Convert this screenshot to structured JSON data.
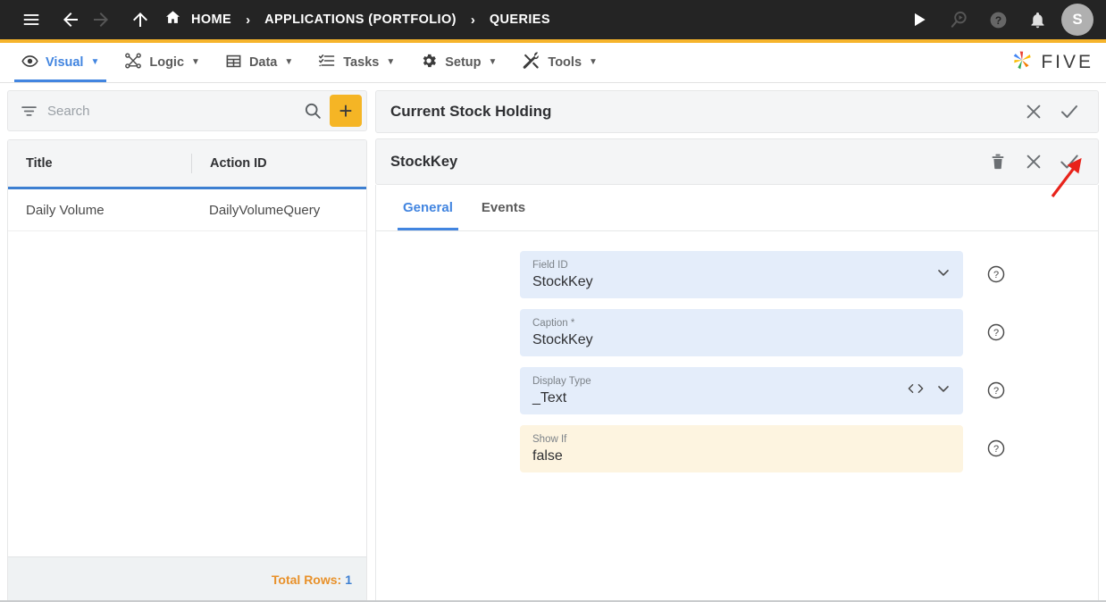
{
  "topbar": {
    "menu_icon": "hamburger-menu-icon",
    "back_icon": "arrow-left-icon",
    "forward_icon": "arrow-right-icon",
    "up_icon": "arrow-up-icon",
    "home_icon": "home-icon",
    "breadcrumbs": [
      {
        "label": "HOME"
      },
      {
        "label": "APPLICATIONS (PORTFOLIO)"
      },
      {
        "label": "QUERIES"
      }
    ],
    "separator": "›",
    "run_icon": "play-icon",
    "search_run_icon": "search-play-icon",
    "help_icon": "question-circle-icon",
    "notification_icon": "bell-icon",
    "avatar_initial": "S",
    "accent_color": "#f6b42c",
    "background_color": "#242424"
  },
  "menubar": {
    "items": [
      {
        "label": "Visual",
        "icon": "eye-icon",
        "active": true
      },
      {
        "label": "Logic",
        "icon": "nodes-icon",
        "active": false
      },
      {
        "label": "Data",
        "icon": "table-grid-icon",
        "active": false
      },
      {
        "label": "Tasks",
        "icon": "checklist-icon",
        "active": false
      },
      {
        "label": "Setup",
        "icon": "gear-icon",
        "active": false
      },
      {
        "label": "Tools",
        "icon": "tools-icon",
        "active": false
      }
    ],
    "caret": "▼",
    "brand": "FIVE",
    "active_color": "#4285e0"
  },
  "left_panel": {
    "filter_icon": "filter-icon",
    "search": {
      "value": "",
      "placeholder": "Search"
    },
    "search_icon": "magnifier-icon",
    "add_button": {
      "label": "+",
      "name": "add-record-button",
      "color": "#f5b525"
    },
    "grid": {
      "columns": [
        "Title",
        "Action ID"
      ],
      "rows": [
        {
          "title": "Daily Volume",
          "action_id": "DailyVolumeQuery"
        }
      ]
    },
    "footer": {
      "label": "Total Rows:",
      "value": "1"
    }
  },
  "right_panel": {
    "header": {
      "title": "Current Stock Holding",
      "close_icon": "close-x-icon",
      "confirm_icon": "check-icon"
    },
    "sub_header": {
      "title": "StockKey",
      "delete_icon": "trash-icon",
      "close_icon": "close-x-icon",
      "confirm_icon": "check-icon"
    },
    "tabs": [
      {
        "label": "General",
        "active": true
      },
      {
        "label": "Events",
        "active": false
      }
    ],
    "fields": [
      {
        "label": "Field ID",
        "value": "StockKey",
        "style": "blue",
        "adornments": [
          "chevron-down-icon"
        ],
        "help_icon": "question-circle-icon"
      },
      {
        "label": "Caption *",
        "value": "StockKey",
        "style": "blue",
        "adornments": [],
        "help_icon": "question-circle-icon"
      },
      {
        "label": "Display Type",
        "value": "_Text",
        "style": "blue",
        "adornments": [
          "code-brackets-icon",
          "chevron-down-icon"
        ],
        "help_icon": "question-circle-icon"
      },
      {
        "label": "Show If",
        "value": "false",
        "style": "yellow",
        "adornments": [],
        "help_icon": "question-circle-icon"
      }
    ]
  },
  "annotation": {
    "type": "red-arrow",
    "color": "#e8231b",
    "points_to": "sub-header-confirm-check-icon"
  }
}
